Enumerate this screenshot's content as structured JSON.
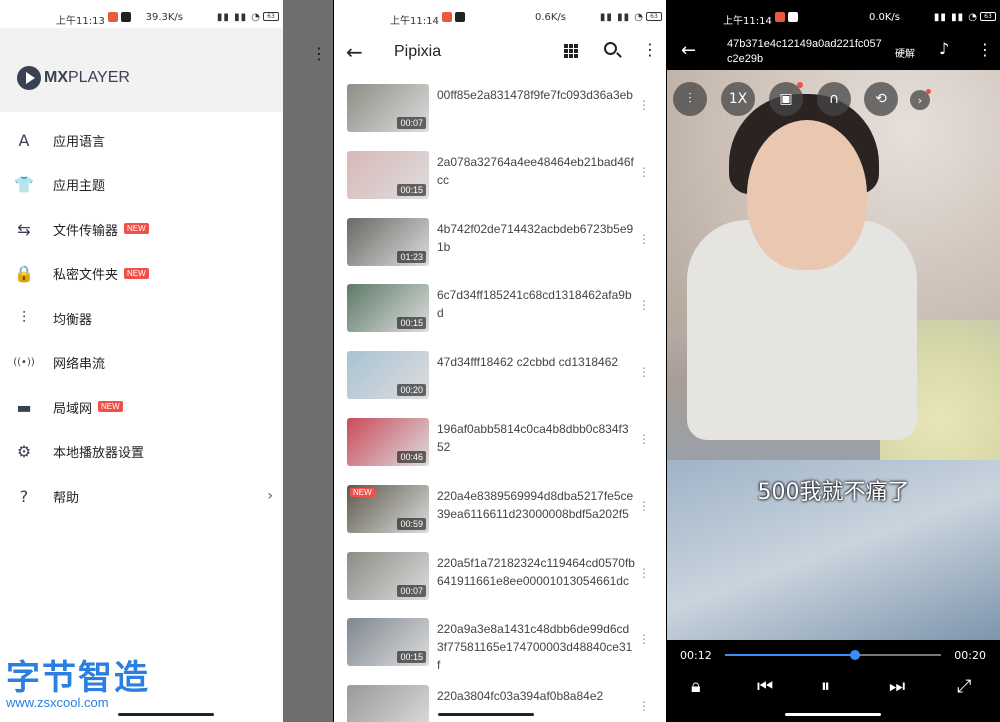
{
  "screen1": {
    "status": {
      "time": "上午11:13",
      "speed": "39.3K/s",
      "battery": "63"
    },
    "logo": {
      "bold": "MX",
      "rest": "PLAYER"
    },
    "menu": [
      {
        "icon": "language-icon",
        "glyph": "A",
        "label": "应用语言",
        "new": false
      },
      {
        "icon": "theme-shirt-icon",
        "glyph": "👕",
        "label": "应用主题",
        "new": false
      },
      {
        "icon": "file-transfer-icon",
        "glyph": "⇆",
        "label": "文件传输器",
        "new": true
      },
      {
        "icon": "private-folder-icon",
        "glyph": "🔒",
        "label": "私密文件夹",
        "new": true
      },
      {
        "icon": "equalizer-icon",
        "glyph": "⫶",
        "label": "均衡器",
        "new": false
      },
      {
        "icon": "network-stream-icon",
        "glyph": "((•))",
        "label": "网络串流",
        "new": false
      },
      {
        "icon": "lan-folder-icon",
        "glyph": "▬",
        "label": "局域网",
        "new": true
      },
      {
        "icon": "settings-gear-icon",
        "glyph": "⚙",
        "label": "本地播放器设置",
        "new": false
      },
      {
        "icon": "help-icon",
        "glyph": "?",
        "label": "帮助",
        "new": false,
        "chevron": true
      }
    ],
    "new_badge": "NEW"
  },
  "screen2": {
    "status": {
      "time": "上午11:14",
      "speed": "0.6K/s",
      "battery": "63"
    },
    "title": "Pipixia",
    "videos": [
      {
        "name": "00ff85e2a831478f9fe7fc093d36a3eb",
        "duration": "00:07",
        "color": "#8a8f84",
        "new": false
      },
      {
        "name": "2a078a32764a4ee48464eb21bad46fcc",
        "duration": "00:15",
        "color": "#d9b7b8",
        "new": false
      },
      {
        "name": "4b742f02de714432acbdeb6723b5e91b",
        "duration": "01:23",
        "color": "#6a6864",
        "new": false
      },
      {
        "name": "6c7d34ff185241c68cd1318462afa9bd",
        "duration": "00:15",
        "color": "#5d7a67",
        "new": false
      },
      {
        "name": "47d34fff18462 c2cbbd cd1318462",
        "duration": "00:20",
        "color": "#a9c2d3",
        "new": false
      },
      {
        "name": "196af0abb5814c0ca4b8dbb0c834f352",
        "duration": "00:46",
        "color": "#c94b5a",
        "new": false
      },
      {
        "name": "220a4e8389569994d8dba5217fe5ce39ea6116611d23000008bdf5a202f5",
        "duration": "00:59",
        "color": "#5c5a4e",
        "new": true
      },
      {
        "name": "220a5f1a72182324c119464cd0570fb641911661e8ee00001013054661dc",
        "duration": "00:07",
        "color": "#8d8b85",
        "new": false
      },
      {
        "name": "220a9a3e8a1431c48dbb6de99d6cd3f77581165e174700003d48840ce31f",
        "duration": "00:15",
        "color": "#7f8790",
        "new": false
      },
      {
        "name": "220a3804fc03a394af0b8a84e2",
        "duration": "",
        "color": "#999999",
        "new": false
      }
    ],
    "new_badge": "NEW"
  },
  "screen3": {
    "status": {
      "time": "上午11:14",
      "speed": "0.0K/s",
      "battery": "63"
    },
    "title": "47b371e4c12149a0ad221fc057c2e29b",
    "decoder": "硬解",
    "speed_label": "1X",
    "subtitle": "500我就不痛了",
    "time_current": "00:12",
    "time_total": "00:20",
    "progress": 0.6
  },
  "watermark": {
    "zh": "字节智造",
    "url": "www.zsxcool.com"
  }
}
